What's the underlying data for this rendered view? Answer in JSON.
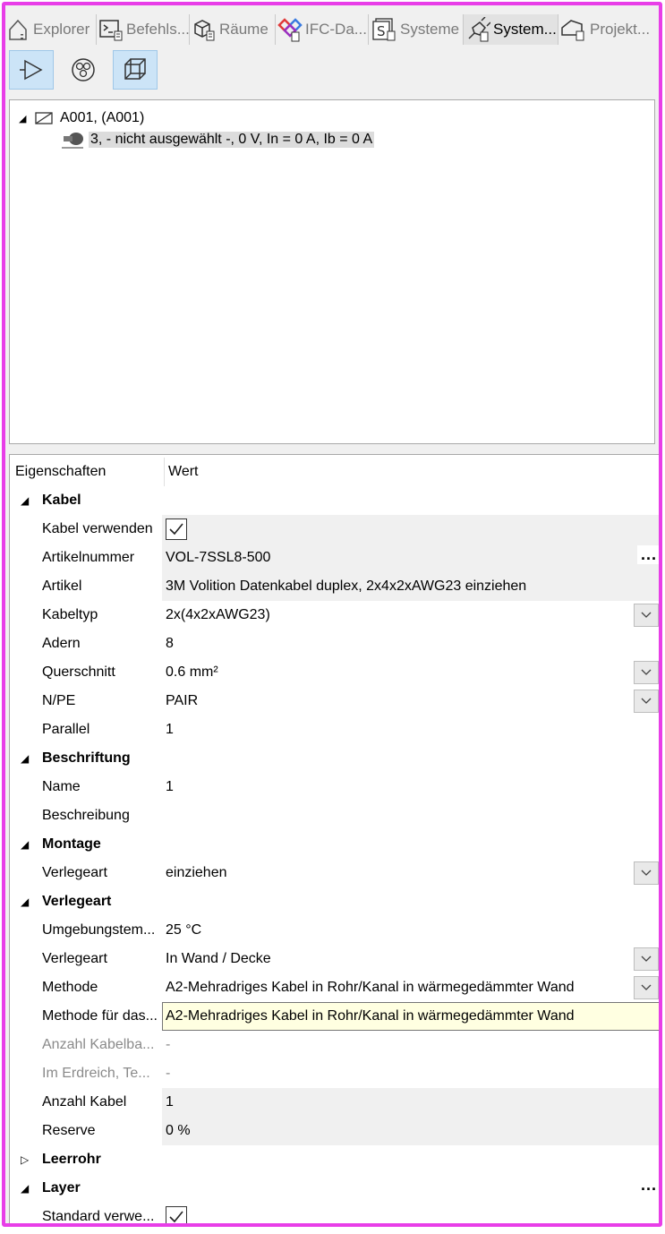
{
  "tabs": [
    {
      "label": "Explorer",
      "icon": "house-icon",
      "active": false
    },
    {
      "label": "Befehls...",
      "icon": "command-icon",
      "active": false
    },
    {
      "label": "Räume",
      "icon": "cube-icon",
      "active": false
    },
    {
      "label": "IFC-Da...",
      "icon": "ifc-icon",
      "active": false
    },
    {
      "label": "Systeme",
      "icon": "systems-icon",
      "active": false
    },
    {
      "label": "System...",
      "icon": "plug-icon",
      "active": true
    },
    {
      "label": "Projekt...",
      "icon": "project-icon",
      "active": false
    }
  ],
  "toolbar": {
    "buttons": [
      {
        "icon": "play-triangle-icon",
        "pressed": true
      },
      {
        "icon": "circles-icon",
        "pressed": false
      },
      {
        "icon": "wire-cube-icon",
        "pressed": true
      }
    ]
  },
  "tree": {
    "root": {
      "label": "A001,  (A001)",
      "expand": "◢"
    },
    "child": {
      "label": "3,  - nicht ausgewählt -, 0 V, In = 0 A, Ib = 0 A"
    }
  },
  "props": {
    "header": {
      "col1": "Eigenschaften",
      "col2": "Wert"
    },
    "kabel": {
      "title": "Kabel",
      "kabel_verwenden": "Kabel verwenden",
      "artikelnummer": {
        "label": "Artikelnummer",
        "value": "VOL-7SSL8-500"
      },
      "artikel": {
        "label": "Artikel",
        "value": "3M Volition Datenkabel duplex, 2x4x2xAWG23  einziehen"
      },
      "kabeltyp": {
        "label": "Kabeltyp",
        "value": "2x(4x2xAWG23)"
      },
      "adern": {
        "label": "Adern",
        "value": "8"
      },
      "querschnitt": {
        "label": "Querschnitt",
        "value": "0.6 mm²"
      },
      "npe": {
        "label": "N/PE",
        "value": "PAIR"
      },
      "parallel": {
        "label": "Parallel",
        "value": "1"
      }
    },
    "beschriftung": {
      "title": "Beschriftung",
      "name": {
        "label": "Name",
        "value": "1"
      },
      "beschreibung": {
        "label": "Beschreibung",
        "value": ""
      }
    },
    "montage": {
      "title": "Montage",
      "verlegeart": {
        "label": "Verlegeart",
        "value": "einziehen"
      }
    },
    "verlegeart": {
      "title": "Verlegeart",
      "umgebung": {
        "label": "Umgebungstem...",
        "value": "25 °C"
      },
      "verlegeart": {
        "label": "Verlegeart",
        "value": "In Wand / Decke"
      },
      "methode": {
        "label": "Methode",
        "value": "A2-Mehradriges Kabel in Rohr/Kanal in wärmegedämmter Wand"
      },
      "methode_fuer": {
        "label": "Methode für das...",
        "value": "A2-Mehradriges Kabel in Rohr/Kanal in wärmegedämmter Wand"
      },
      "anzahl_kabelba": {
        "label": "Anzahl Kabelba...",
        "value": "-"
      },
      "erdreich": {
        "label": "Im Erdreich, Te...",
        "value": "-"
      },
      "anzahl_kabel": {
        "label": "Anzahl Kabel",
        "value": "1"
      },
      "reserve": {
        "label": "Reserve",
        "value": "0 %"
      }
    },
    "leerrohr": {
      "title": "Leerrohr"
    },
    "layer": {
      "title": "Layer",
      "standard": {
        "label": "Standard verwe..."
      }
    },
    "ellipsis": "...",
    "expanded_glyph": "◢",
    "collapsed_glyph": "▷"
  }
}
